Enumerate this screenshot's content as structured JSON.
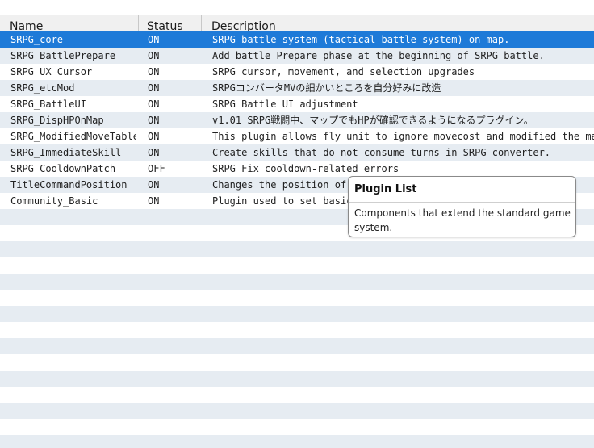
{
  "columns": [
    "Name",
    "Status",
    "Description"
  ],
  "selected_index": 0,
  "plugins": [
    {
      "name": "SRPG_core",
      "status": "ON",
      "description": "SRPG battle system (tactical battle system) on map."
    },
    {
      "name": "SRPG_BattlePrepare",
      "status": "ON",
      "description": "Add battle Prepare phase at the beginning of SRPG battle."
    },
    {
      "name": "SRPG_UX_Cursor",
      "status": "ON",
      "description": "SRPG cursor, movement, and selection upgrades"
    },
    {
      "name": "SRPG_etcMod",
      "status": "ON",
      "description": "SRPGコンバータMVの細かいところを自分好みに改造"
    },
    {
      "name": "SRPG_BattleUI",
      "status": "ON",
      "description": "SRPG Battle UI adjustment"
    },
    {
      "name": "SRPG_DispHPOnMap",
      "status": "ON",
      "description": "v1.01 SRPG戦闘中、マップでもHPが確認できるようになるプラグイン。"
    },
    {
      "name": "SRPG_ModifiedMoveTable",
      "status": "ON",
      "description": "This plugin allows fly unit to ignore movecost and modified the ma…"
    },
    {
      "name": "SRPG_ImmediateSkill",
      "status": "ON",
      "description": "Create skills that do not consume turns in SRPG converter."
    },
    {
      "name": "SRPG_CooldownPatch",
      "status": "OFF",
      "description": "SRPG Fix cooldown-related errors"
    },
    {
      "name": "TitleCommandPosition",
      "status": "ON",
      "description": "Changes the position of"
    },
    {
      "name": "Community_Basic",
      "status": "ON",
      "description": "Plugin used to set basic"
    }
  ],
  "empty_row_count": 15,
  "tooltip": {
    "title": "Plugin List",
    "body": "Components that extend the standard game system."
  },
  "colors": {
    "selection": "#1e7ad8",
    "stripe": "#e6ecf2",
    "header_bg": "#f0f0f0"
  }
}
